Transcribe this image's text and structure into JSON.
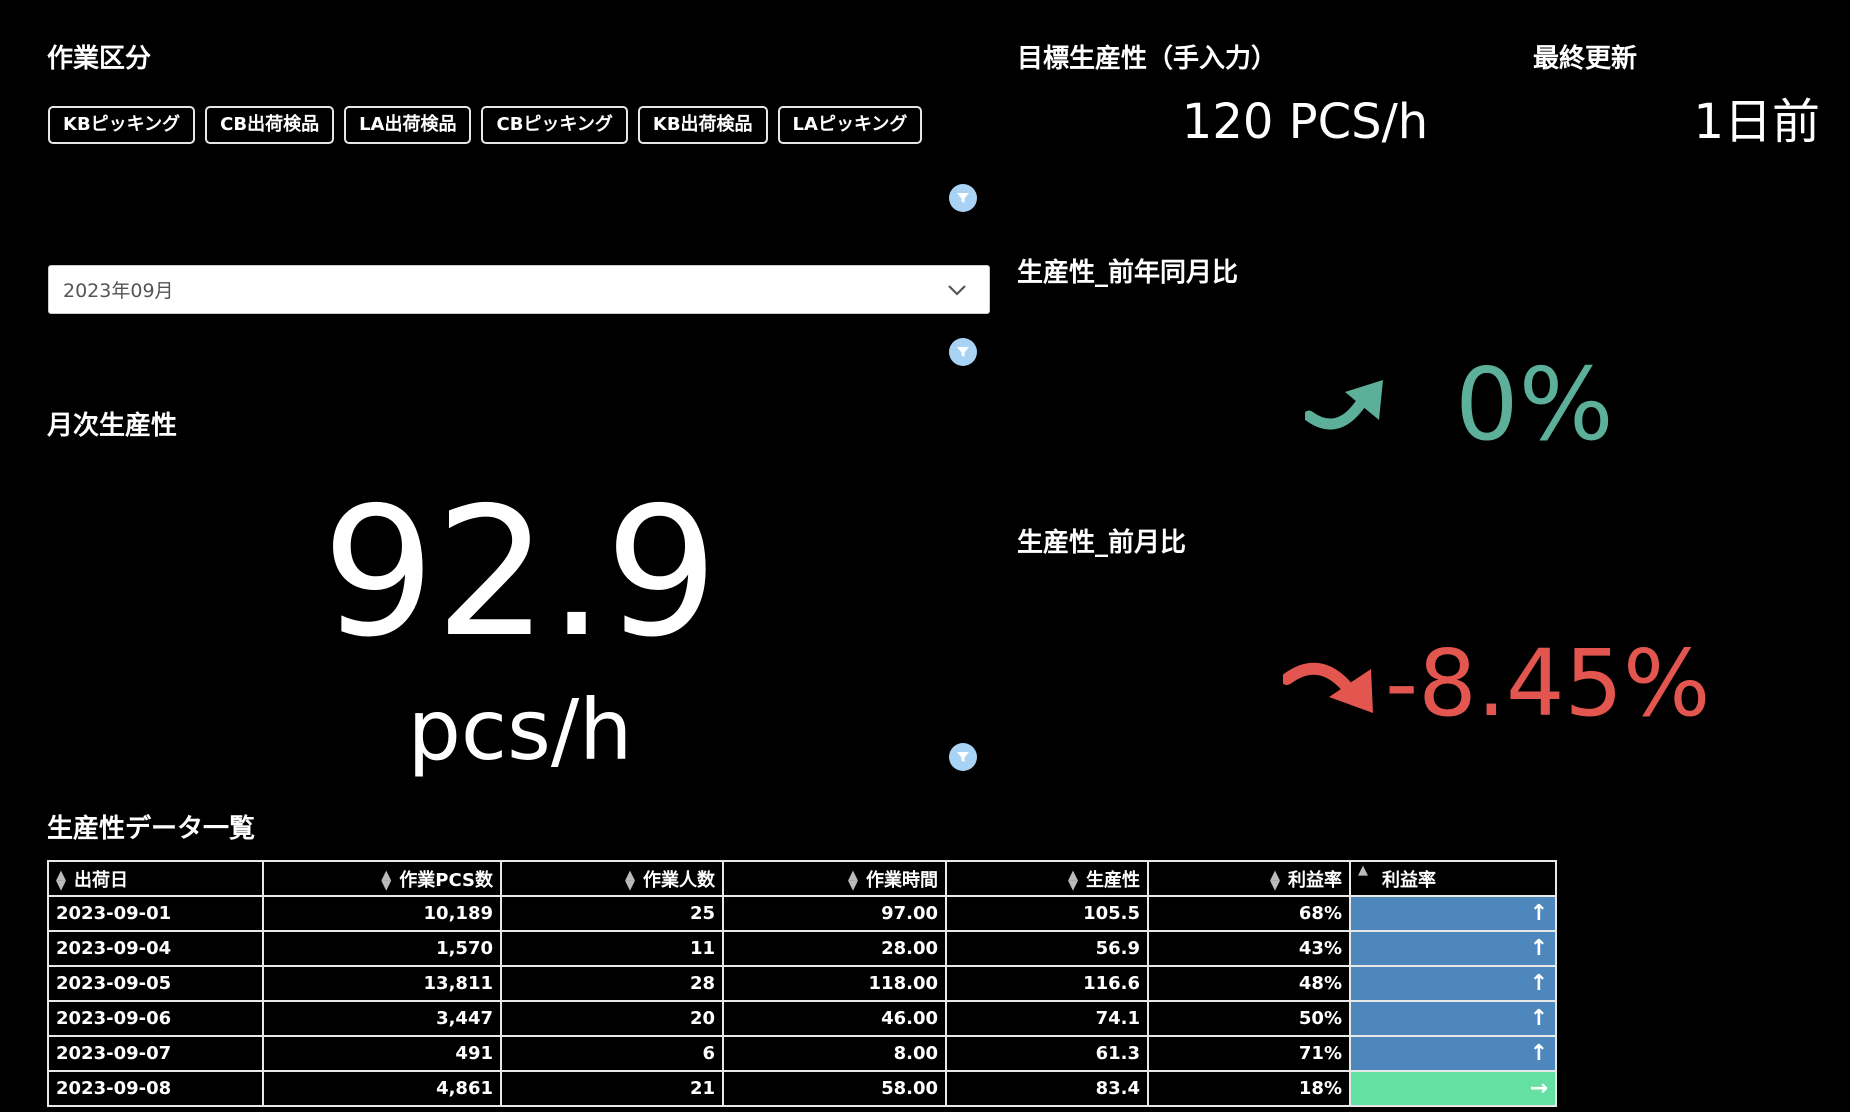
{
  "filter": {
    "title": "作業区分",
    "chips": [
      "KBピッキング",
      "CB出荷検品",
      "LA出荷検品",
      "CBピッキング",
      "KB出荷検品",
      "LAピッキング"
    ]
  },
  "month_select": {
    "value": "2023年09月"
  },
  "monthly": {
    "title": "月次生産性",
    "value": "92.9",
    "unit": "pcs/h"
  },
  "target": {
    "title": "目標生産性（手入力）",
    "value": "120 PCS/h"
  },
  "last_update": {
    "title": "最終更新",
    "value": "1日前"
  },
  "yoy": {
    "title": "生産性_前年同月比",
    "value": "0%",
    "color": "#5cb09a",
    "icon": "trend-up-arrow-icon"
  },
  "mom": {
    "title": "生産性_前月比",
    "value": "-8.45%",
    "color": "#e2564f",
    "icon": "trend-down-arrow-icon"
  },
  "table": {
    "title": "生産性データ一覧",
    "headers": [
      "出荷日",
      "作業PCS数",
      "作業人数",
      "作業時間",
      "生産性",
      "利益率",
      "利益率"
    ],
    "rows": [
      {
        "date": "2023-09-01",
        "pcs": "10,189",
        "people": "25",
        "hours": "97.00",
        "prod": "105.5",
        "margin": "68%",
        "trend": "↑",
        "color": "#4d87bb"
      },
      {
        "date": "2023-09-04",
        "pcs": "1,570",
        "people": "11",
        "hours": "28.00",
        "prod": "56.9",
        "margin": "43%",
        "trend": "↑",
        "color": "#4d87bb"
      },
      {
        "date": "2023-09-05",
        "pcs": "13,811",
        "people": "28",
        "hours": "118.00",
        "prod": "116.6",
        "margin": "48%",
        "trend": "↑",
        "color": "#4d87bb"
      },
      {
        "date": "2023-09-06",
        "pcs": "3,447",
        "people": "20",
        "hours": "46.00",
        "prod": "74.1",
        "margin": "50%",
        "trend": "↑",
        "color": "#4d87bb"
      },
      {
        "date": "2023-09-07",
        "pcs": "491",
        "people": "6",
        "hours": "8.00",
        "prod": "61.3",
        "margin": "71%",
        "trend": "↑",
        "color": "#4d87bb"
      },
      {
        "date": "2023-09-08",
        "pcs": "4,861",
        "people": "21",
        "hours": "58.00",
        "prod": "83.4",
        "margin": "18%",
        "trend": "→",
        "color": "#63e0a2"
      }
    ]
  }
}
